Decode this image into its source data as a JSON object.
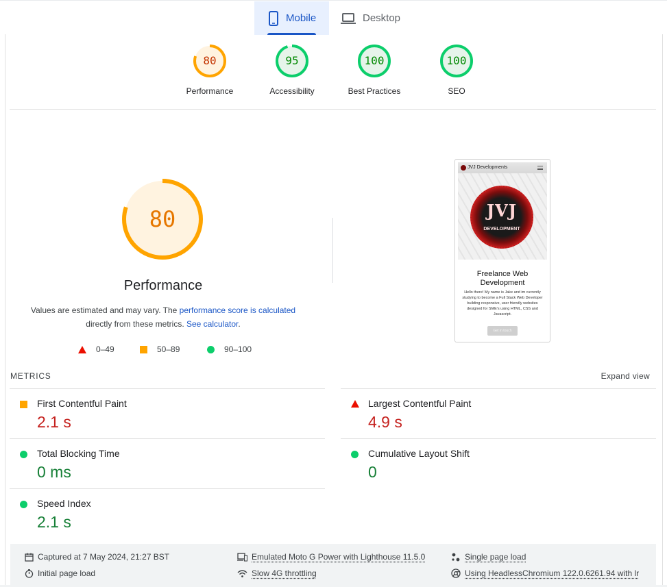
{
  "tabs": {
    "mobile": "Mobile",
    "desktop": "Desktop"
  },
  "gauges": [
    {
      "score": "80",
      "label": "Performance",
      "color": "#ffa400",
      "text_color": "#c33300",
      "bg": "#fff3e0"
    },
    {
      "score": "95",
      "label": "Accessibility",
      "color": "#0cce6b",
      "text_color": "#008800",
      "bg": "#e6f4ea"
    },
    {
      "score": "100",
      "label": "Best Practices",
      "color": "#0cce6b",
      "text_color": "#008800",
      "bg": "#e6f4ea"
    },
    {
      "score": "100",
      "label": "SEO",
      "color": "#0cce6b",
      "text_color": "#008800",
      "bg": "#e6f4ea"
    }
  ],
  "performance": {
    "score": "80",
    "title": "Performance",
    "desc_prefix": "Values are estimated and may vary. The ",
    "desc_link1": "performance score is calculated",
    "desc_mid": " directly from these metrics. ",
    "desc_link2": "See calculator",
    "desc_suffix": "."
  },
  "legend": {
    "fail": "0–49",
    "average": "50–89",
    "pass": "90–100"
  },
  "screenshot": {
    "site_name": "JVJ Developments",
    "logo_text": "JVJ",
    "logo_sub": "DEVELOPMENT",
    "heading": "Freelance Web Development",
    "body": "Hello there! My name is Jake and im currently studying to become a Full Stack Web Developer building responsive, user friendly websites designed for SME's using HTML, CSS and Javascript.",
    "button": "Get in touch"
  },
  "metrics": {
    "header": "METRICS",
    "expand": "Expand view",
    "items": [
      {
        "name": "First Contentful Paint",
        "value": "2.1 s",
        "status": "average"
      },
      {
        "name": "Largest Contentful Paint",
        "value": "4.9 s",
        "status": "fail"
      },
      {
        "name": "Total Blocking Time",
        "value": "0 ms",
        "status": "pass"
      },
      {
        "name": "Cumulative Layout Shift",
        "value": "0",
        "status": "pass"
      },
      {
        "name": "Speed Index",
        "value": "2.1 s",
        "status": "pass"
      }
    ]
  },
  "footer": {
    "captured": "Captured at 7 May 2024, 21:27 BST",
    "initial": "Initial page load",
    "emulated": "Emulated Moto G Power with Lighthouse 11.5.0",
    "throttling": "Slow 4G throttling",
    "single": "Single page load",
    "browser": "Using HeadlessChromium 122.0.6261.94 with lr"
  }
}
